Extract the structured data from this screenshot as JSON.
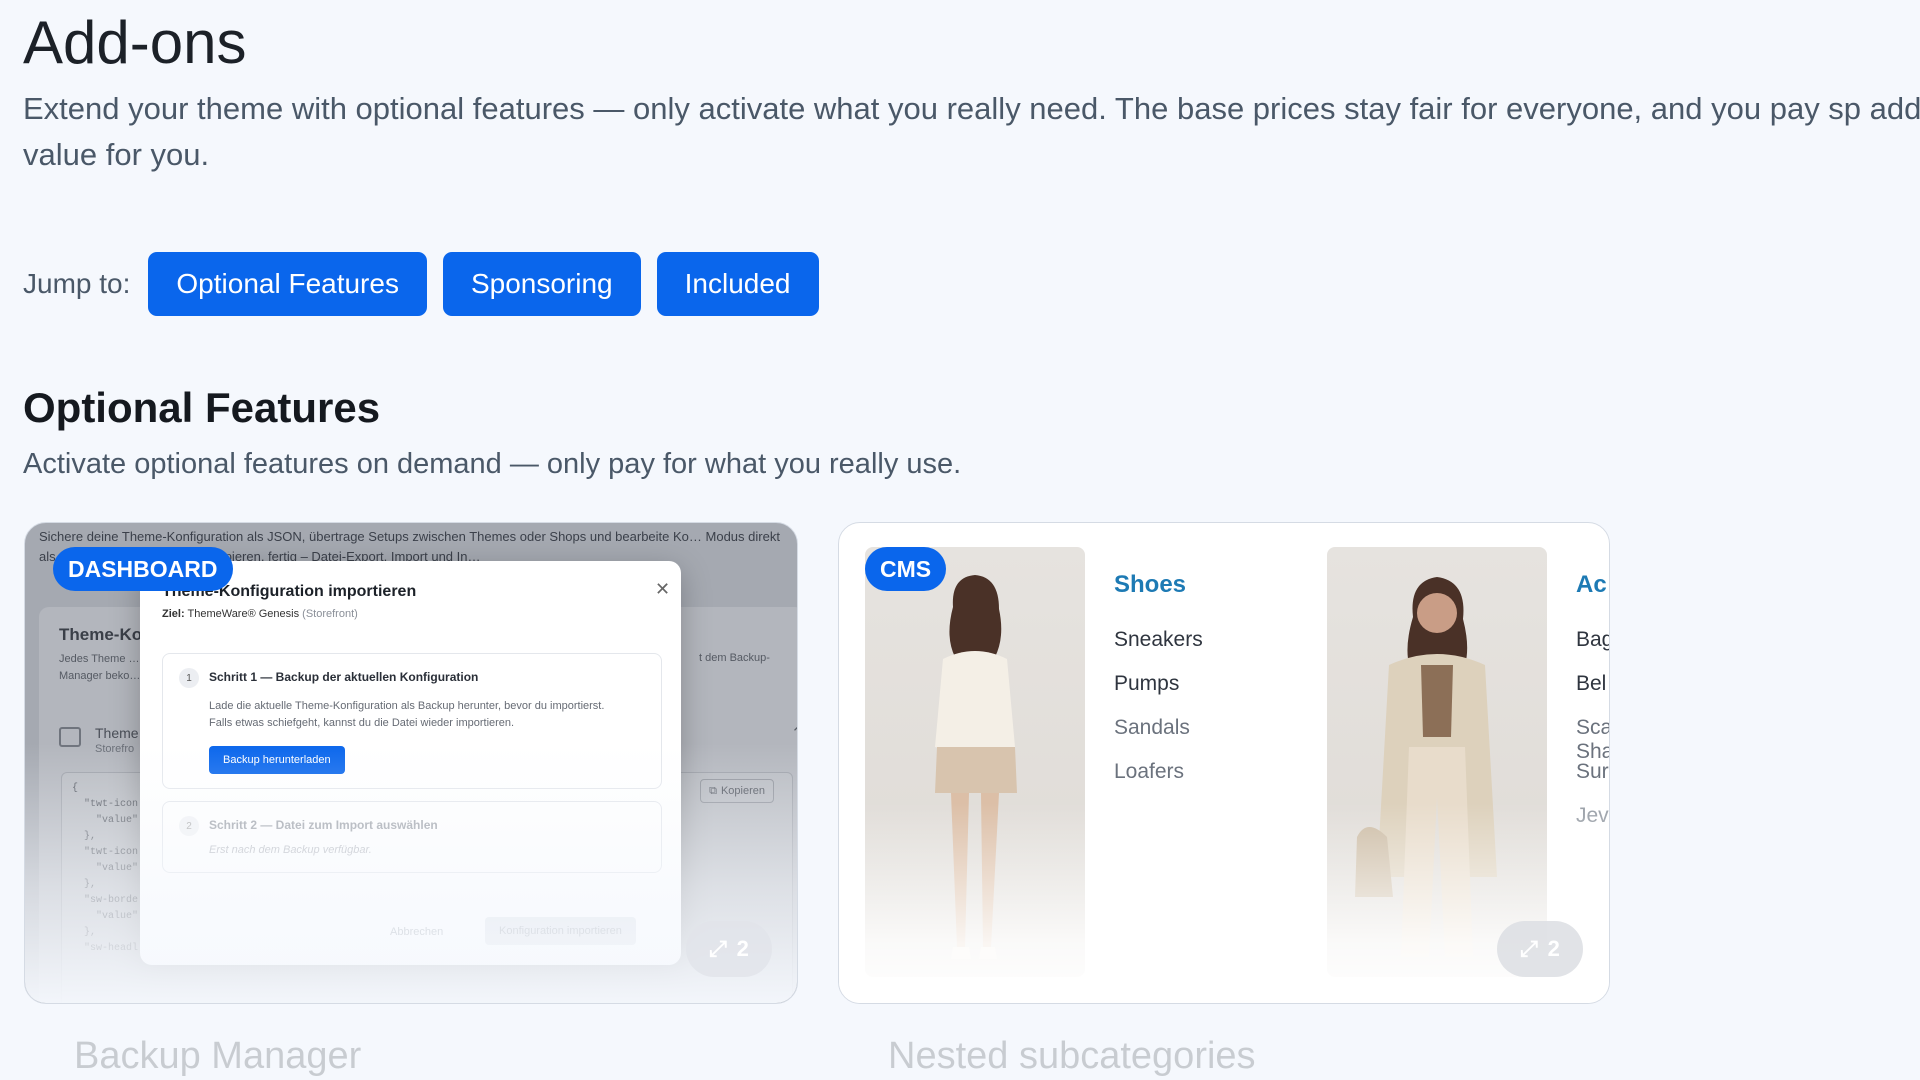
{
  "page": {
    "title": "Add-ons",
    "intro": "Extend your theme with optional features — only activate what you really need. The base prices stay fair for everyone, and you pay sp add value for you."
  },
  "jump": {
    "label": "Jump to:",
    "links": [
      "Optional Features",
      "Sponsoring",
      "Included"
    ]
  },
  "section": {
    "title": "Optional Features",
    "subtitle": "Activate optional features on demand — only pay for what you really use."
  },
  "cards": [
    {
      "badge": "DASHBOARD",
      "caption": "Backup Manager",
      "count": "2",
      "preview": {
        "bg_text": "Sichere deine Theme-Konfiguration als JSON, übertrage Setups zwischen Themes oder Shops und bearbeite Ko… Modus direkt als JSON. Aufklappen, JSON kopieren, fertig – Datei-Export, Import und In…",
        "panel_title": "Theme-Ko",
        "panel_desc": "Jedes Theme … Manager beko…",
        "panel_right": "t dem Backup-",
        "row_label": "Theme",
        "row_sub": "Storefro",
        "code": "{\n  \"twt-icon\n    \"value\"\n  },\n  \"twt-icon\n    \"value\"\n  },\n  \"sw-borde\n    \"value\"\n  },\n  \"sw-headl",
        "copy_label": "Kopieren",
        "modal": {
          "title": "Theme-Konfiguration importieren",
          "target_label": "Ziel:",
          "target_value": "ThemeWare® Genesis",
          "target_context": "(Storefront)",
          "step1_num": "1",
          "step1_title": "Schritt 1 — Backup der aktuellen Konfiguration",
          "step1_desc": "Lade die aktuelle Theme-Konfiguration als Backup herunter, bevor du importierst. Falls etwas schiefgeht, kannst du die Datei wieder importieren.",
          "step1_button": "Backup herunterladen",
          "step2_num": "2",
          "step2_title": "Schritt 2 — Datei zum Import auswählen",
          "step2_desc": "Erst nach dem Backup verfügbar.",
          "cancel": "Abbrechen",
          "import": "Konfiguration importieren"
        }
      }
    },
    {
      "badge": "CMS",
      "caption": "Nested subcategories",
      "count": "2",
      "columns": [
        {
          "title": "Shoes",
          "items": [
            "Sneakers",
            "Pumps",
            "Sandals",
            "Loafers"
          ]
        },
        {
          "title": "Ac",
          "items": [
            "Bag",
            "Bel",
            "Sca Sha",
            "Sur",
            "Jev"
          ]
        }
      ]
    }
  ],
  "colors": {
    "accent": "#0a66ec",
    "category_title": "#1d7ab4",
    "background": "#f5f8fd"
  },
  "icons": [
    "expand-icon",
    "close-icon",
    "chevron-up-icon",
    "copy-icon",
    "list-icon"
  ]
}
